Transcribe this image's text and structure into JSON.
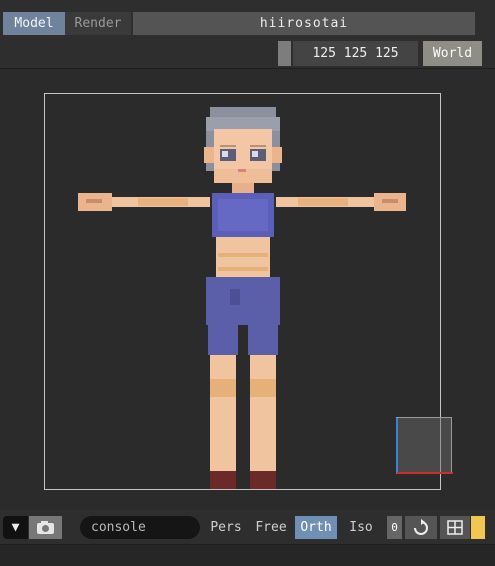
{
  "tabs": [
    {
      "label": "Model",
      "active": true
    },
    {
      "label": "Render",
      "active": false
    }
  ],
  "model_name": "hiirosotai",
  "background_color_value": "125 125 125",
  "space_toggle_label": "World",
  "console": {
    "placeholder": "console"
  },
  "view_modes": [
    {
      "label": "Pers",
      "active": false
    },
    {
      "label": "Free",
      "active": false
    },
    {
      "label": "Orth",
      "active": true
    },
    {
      "label": "Iso",
      "active": false
    }
  ],
  "counter_label": "0",
  "icons": {
    "menu": "triangle-down-icon",
    "camera": "camera-icon",
    "reset": "rotate-reset-icon",
    "grid": "grid-icon"
  },
  "colors": {
    "accent": "#6f8fb4",
    "active_tab": "#6f849c",
    "highlight": "#f0c751",
    "axis_x": "#d12b2b",
    "axis_z": "#3f7fd4"
  }
}
